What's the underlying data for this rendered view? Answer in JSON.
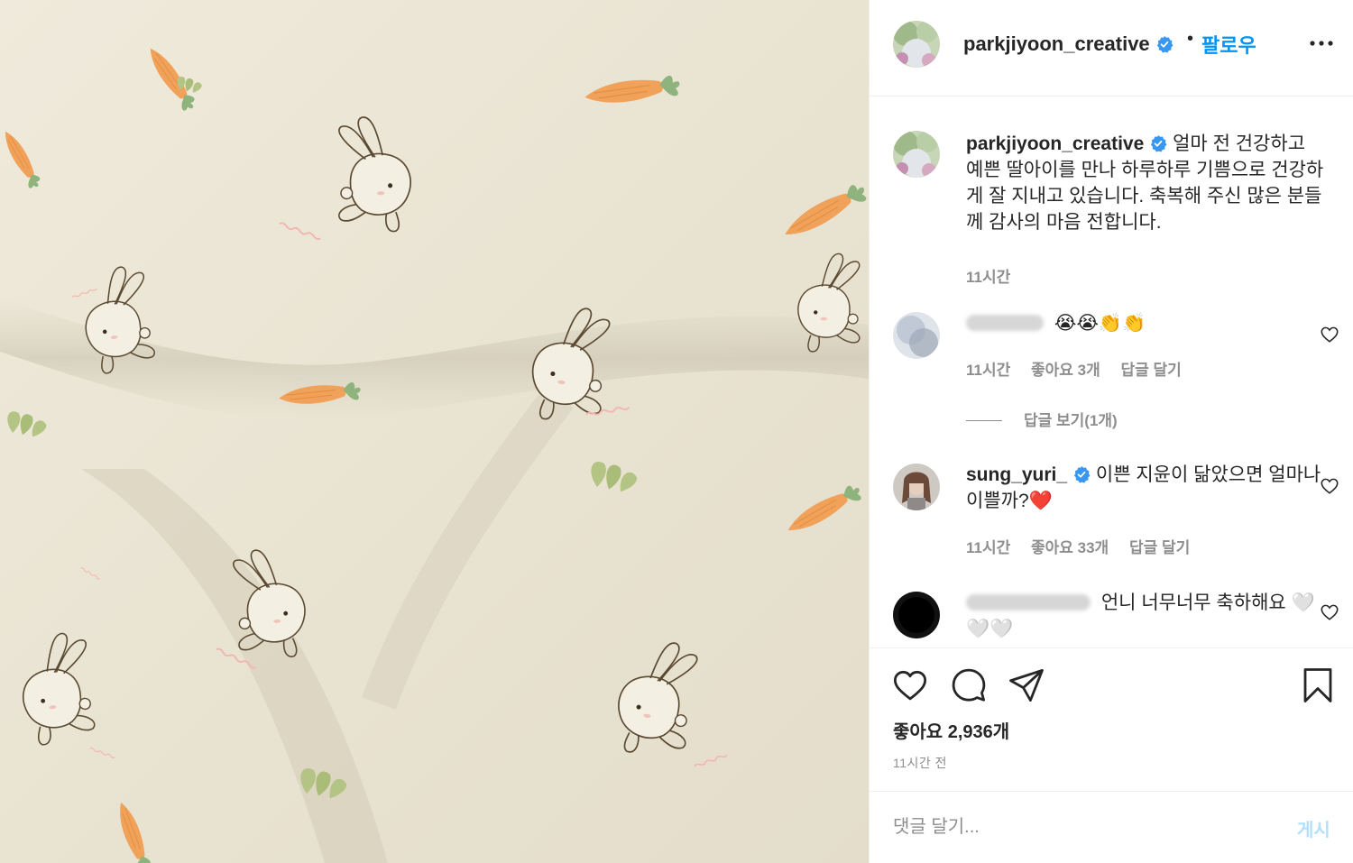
{
  "post": {
    "username": "parkjiyoon_creative",
    "follow_label": "팔로우",
    "dot": "•",
    "caption": "얼마 전 건강하고 예쁜 딸아이를 만나 하루하루 기쁨으로 건강하게 잘 지내고 있습니다. 축복해 주신 많은 분들께 감사의 마음 전합니다.",
    "caption_time": "11시간"
  },
  "comments": [
    {
      "username": "",
      "text": "😭😭👏👏",
      "time": "11시간",
      "likes": "좋아요 3개",
      "reply_label": "답글 달기",
      "view_replies": "답글 보기(1개)"
    },
    {
      "username": "sung_yuri_",
      "text": "이쁜 지윤이 닮았으면 얼마나 이쁠까?❤️",
      "time": "11시간",
      "likes": "좋아요 33개",
      "reply_label": "답글 달기"
    },
    {
      "username": "",
      "text": "언니 너무너무 축하해요 🤍🤍🤍"
    }
  ],
  "actions": {
    "icons": [
      "heart-icon",
      "comment-icon",
      "share-icon",
      "bookmark-icon"
    ],
    "likes": "좋아요 2,936개",
    "time_ago": "11시간 전"
  },
  "add_comment": {
    "placeholder": "댓글 달기...",
    "post_label": "게시"
  },
  "colors": {
    "accent": "#0095f6",
    "verified": "#3897f0",
    "muted": "#8e8e8e",
    "post_disabled": "#b2dffc"
  }
}
